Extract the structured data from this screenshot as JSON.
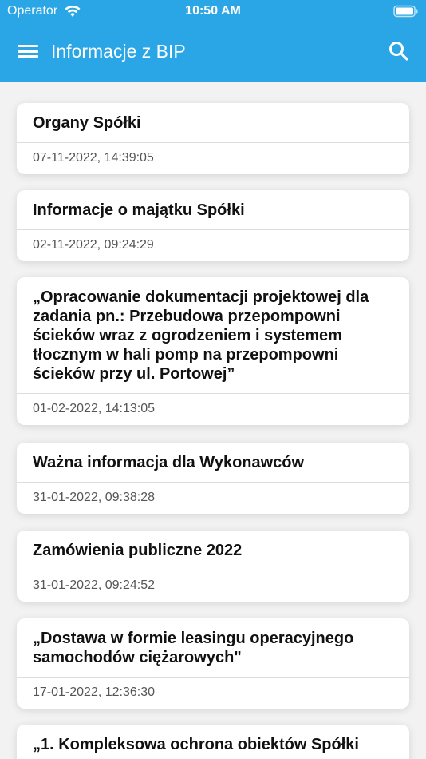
{
  "status_bar": {
    "carrier": "Operator",
    "time": "10:50 AM"
  },
  "nav": {
    "title": "Informacje z BIP",
    "menu_icon": "hamburger-menu-icon",
    "search_icon": "search-icon"
  },
  "colors": {
    "accent": "#2aa6e6",
    "background": "#f2f2f2",
    "card": "#ffffff"
  },
  "items": [
    {
      "title": "Organy Spółki",
      "date": "07-11-2022, 14:39:05"
    },
    {
      "title": "Informacje o majątku Spółki",
      "date": "02-11-2022, 09:24:29"
    },
    {
      "title": "„Opracowanie dokumentacji projektowej dla zadania pn.: Przebudowa przepompowni ścieków wraz z ogrodzeniem i systemem tłocznym w hali pomp na  przepompowni ścieków przy ul. Portowej”",
      "date": "01-02-2022, 14:13:05"
    },
    {
      "title": "Ważna informacja dla Wykonawców",
      "date": "31-01-2022, 09:38:28"
    },
    {
      "title": "Zamówienia publiczne 2022",
      "date": "31-01-2022, 09:24:52"
    },
    {
      "title": "„Dostawa w formie leasingu operacyjnego samochodów ciężarowych\"",
      "date": "17-01-2022, 12:36:30"
    },
    {
      "title": "„1. Kompleksowa ochrona obiektów Spółki",
      "date": ""
    }
  ]
}
